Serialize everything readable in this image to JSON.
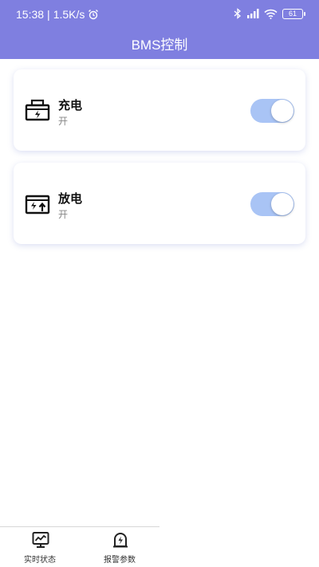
{
  "status_bar": {
    "time": "15:38",
    "speed": "1.5K/s",
    "battery": "61"
  },
  "header": {
    "title": "BMS控制"
  },
  "controls": [
    {
      "label": "充电",
      "value": "开",
      "enabled": true,
      "icon": "charge-battery-icon"
    },
    {
      "label": "放电",
      "value": "开",
      "enabled": true,
      "icon": "discharge-battery-icon"
    }
  ],
  "bottom_nav": {
    "items": [
      {
        "label": "实时状态",
        "icon": "monitor-chart-icon"
      },
      {
        "label": "报警参数",
        "icon": "alarm-bolt-icon"
      }
    ]
  },
  "colors": {
    "header": "#7f7fe0",
    "toggle_on": "#a9c4f5"
  }
}
